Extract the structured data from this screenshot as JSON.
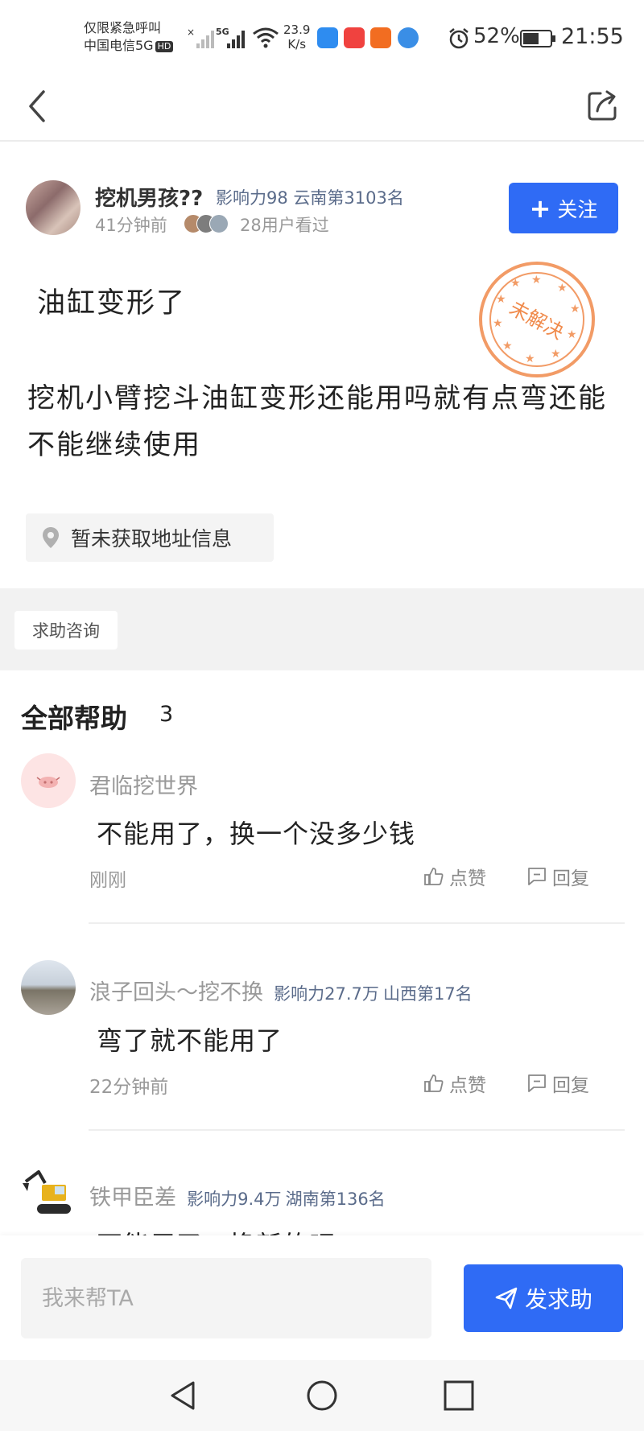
{
  "status_bar": {
    "carrier_line1": "仅限紧急呼叫",
    "carrier_line2": "中国电信5G",
    "hd_badge": "HD",
    "network_speed_value": "23.9",
    "network_speed_unit": "K/s",
    "battery_percent": "52%",
    "time": "21:55",
    "icons": [
      "no-signal-icon",
      "5g-signal-icon",
      "wifi-icon",
      "app-icon-blue",
      "app-icon-red",
      "app-icon-orange",
      "app-icon-globe",
      "alarm-icon",
      "battery-icon"
    ]
  },
  "nav": {
    "back_icon": "chevron-left-icon",
    "share_icon": "share-icon"
  },
  "post": {
    "author": {
      "name": "挖机男孩??",
      "influence": "影响力98",
      "rank": "云南第3103名",
      "time": "41分钟前",
      "views": "28用户看过"
    },
    "follow_label": "关注",
    "title": "油缸变形了",
    "body": "挖机小臂挖斗油缸变形还能用吗就有点弯还能不能继续使用",
    "stamp_text": "未解决",
    "location": "暂未获取地址信息",
    "tag": "求助咨询"
  },
  "answers": {
    "title": "全部帮助",
    "count": "3",
    "items": [
      {
        "name": "君临挖世界",
        "influence": "",
        "rank": "",
        "text": "不能用了，换一个没多少钱",
        "time": "刚刚",
        "like_label": "点赞",
        "reply_label": "回复"
      },
      {
        "name": "浪子回头～挖不换",
        "influence": "影响力27.7万",
        "rank": "山西第17名",
        "text": "弯了就不能用了",
        "time": "22分钟前",
        "like_label": "点赞",
        "reply_label": "回复"
      },
      {
        "name": "铁甲臣差",
        "influence": "影响力9.4万",
        "rank": "湖南第136名",
        "text": "不能用了，换新的吧"
      }
    ]
  },
  "bottom": {
    "input_placeholder": "我来帮TA",
    "send_label": "发求助"
  },
  "colors": {
    "accent": "#2f6bf5",
    "stamp": "#f08a4b",
    "meta_blue": "#5a6b8a"
  }
}
